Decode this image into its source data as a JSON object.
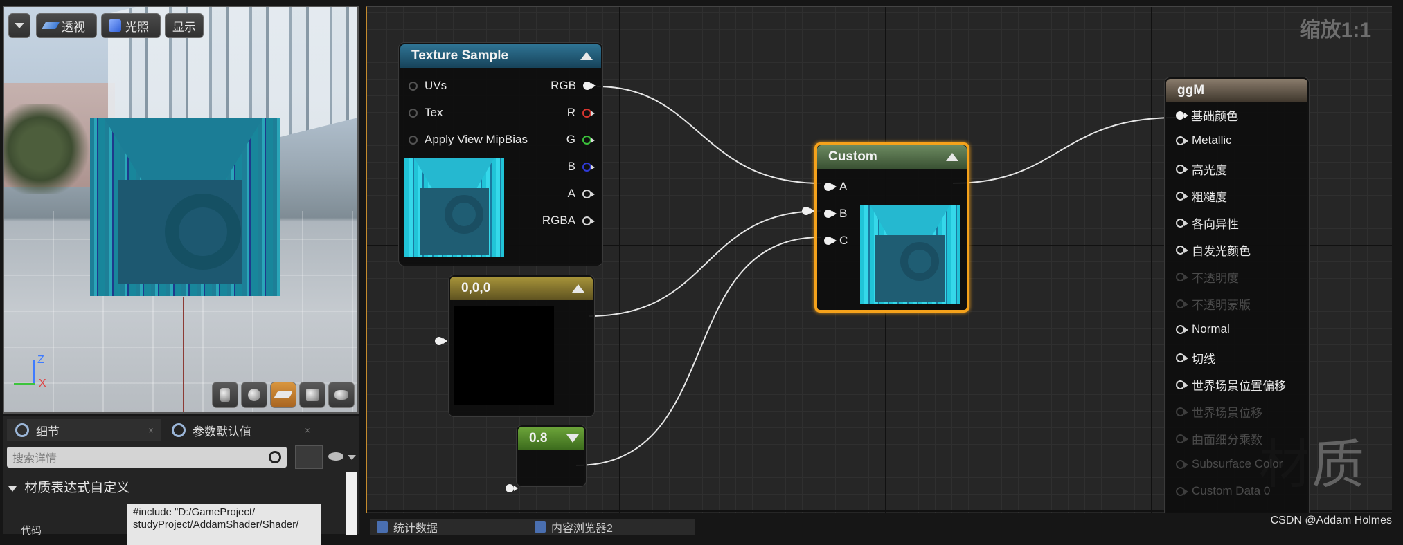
{
  "viewport": {
    "dropdown_label": "",
    "buttons": [
      {
        "label": "透视",
        "icon": "perspective-icon"
      },
      {
        "label": "光照",
        "icon": "lit-cube-icon"
      },
      {
        "label": "显示",
        "icon": ""
      }
    ],
    "axis": {
      "z": "Z",
      "x": "X"
    },
    "view_modes": [
      "cylinder-icon",
      "sphere-icon",
      "plane-icon",
      "cube-icon",
      "teapot-icon"
    ],
    "active_view_mode": "plane-icon"
  },
  "details": {
    "tabs": [
      {
        "label": "细节",
        "icon": "details-search-icon",
        "close": "×"
      },
      {
        "label": "参数默认值",
        "icon": "params-search-icon",
        "close": "×"
      }
    ],
    "search_placeholder": "搜索详情",
    "section_title": "材质表达式自定义",
    "code_label": "代码",
    "code_value_line1": "#include \"D:/GameProject/",
    "code_value_line2": "studyProject/AddamShader/Shader/"
  },
  "graph": {
    "zoom_label": "缩放1:1",
    "watermark": "材质",
    "texture_node": {
      "title": "Texture Sample",
      "inputs": [
        "UVs",
        "Tex",
        "Apply View MipBias"
      ],
      "outputs": [
        "RGB",
        "R",
        "G",
        "B",
        "A",
        "RGBA"
      ]
    },
    "constant3_node": {
      "title": "0,0,0"
    },
    "scalar_node": {
      "title": "0.8"
    },
    "custom_node": {
      "title": "Custom",
      "inputs": [
        "A",
        "B",
        "C"
      ]
    },
    "material_node": {
      "title": "ggM",
      "inputs": [
        {
          "label": "基础颜色",
          "enabled": true,
          "connected": true
        },
        {
          "label": "Metallic",
          "enabled": true,
          "connected": false
        },
        {
          "label": "高光度",
          "enabled": true,
          "connected": false
        },
        {
          "label": "粗糙度",
          "enabled": true,
          "connected": false
        },
        {
          "label": "各向异性",
          "enabled": true,
          "connected": false
        },
        {
          "label": "自发光颜色",
          "enabled": true,
          "connected": false
        },
        {
          "label": "不透明度",
          "enabled": false,
          "connected": false
        },
        {
          "label": "不透明蒙版",
          "enabled": false,
          "connected": false
        },
        {
          "label": "Normal",
          "enabled": true,
          "connected": false
        },
        {
          "label": "切线",
          "enabled": true,
          "connected": false
        },
        {
          "label": "世界场景位置偏移",
          "enabled": true,
          "connected": false
        },
        {
          "label": "世界场景位移",
          "enabled": false,
          "connected": false
        },
        {
          "label": "曲面细分乘数",
          "enabled": false,
          "connected": false
        },
        {
          "label": "Subsurface Color",
          "enabled": false,
          "connected": false
        },
        {
          "label": "Custom Data 0",
          "enabled": false,
          "connected": false
        }
      ]
    },
    "colors": {
      "selected_border": "#f5a21b",
      "wire": "#e6e6e6",
      "texture_header": "#1e5a78",
      "custom_header": "#4f6a45",
      "constant_header": "#8a7a2c",
      "scalar_header": "#5a8a2e",
      "material_header": "#6b5e4e"
    }
  },
  "bottom_tabs": [
    {
      "label": "统计数据",
      "icon": "stats-icon"
    },
    {
      "label": "内容浏览器2",
      "icon": "content-browser-icon"
    }
  ],
  "credit": "CSDN @Addam Holmes"
}
